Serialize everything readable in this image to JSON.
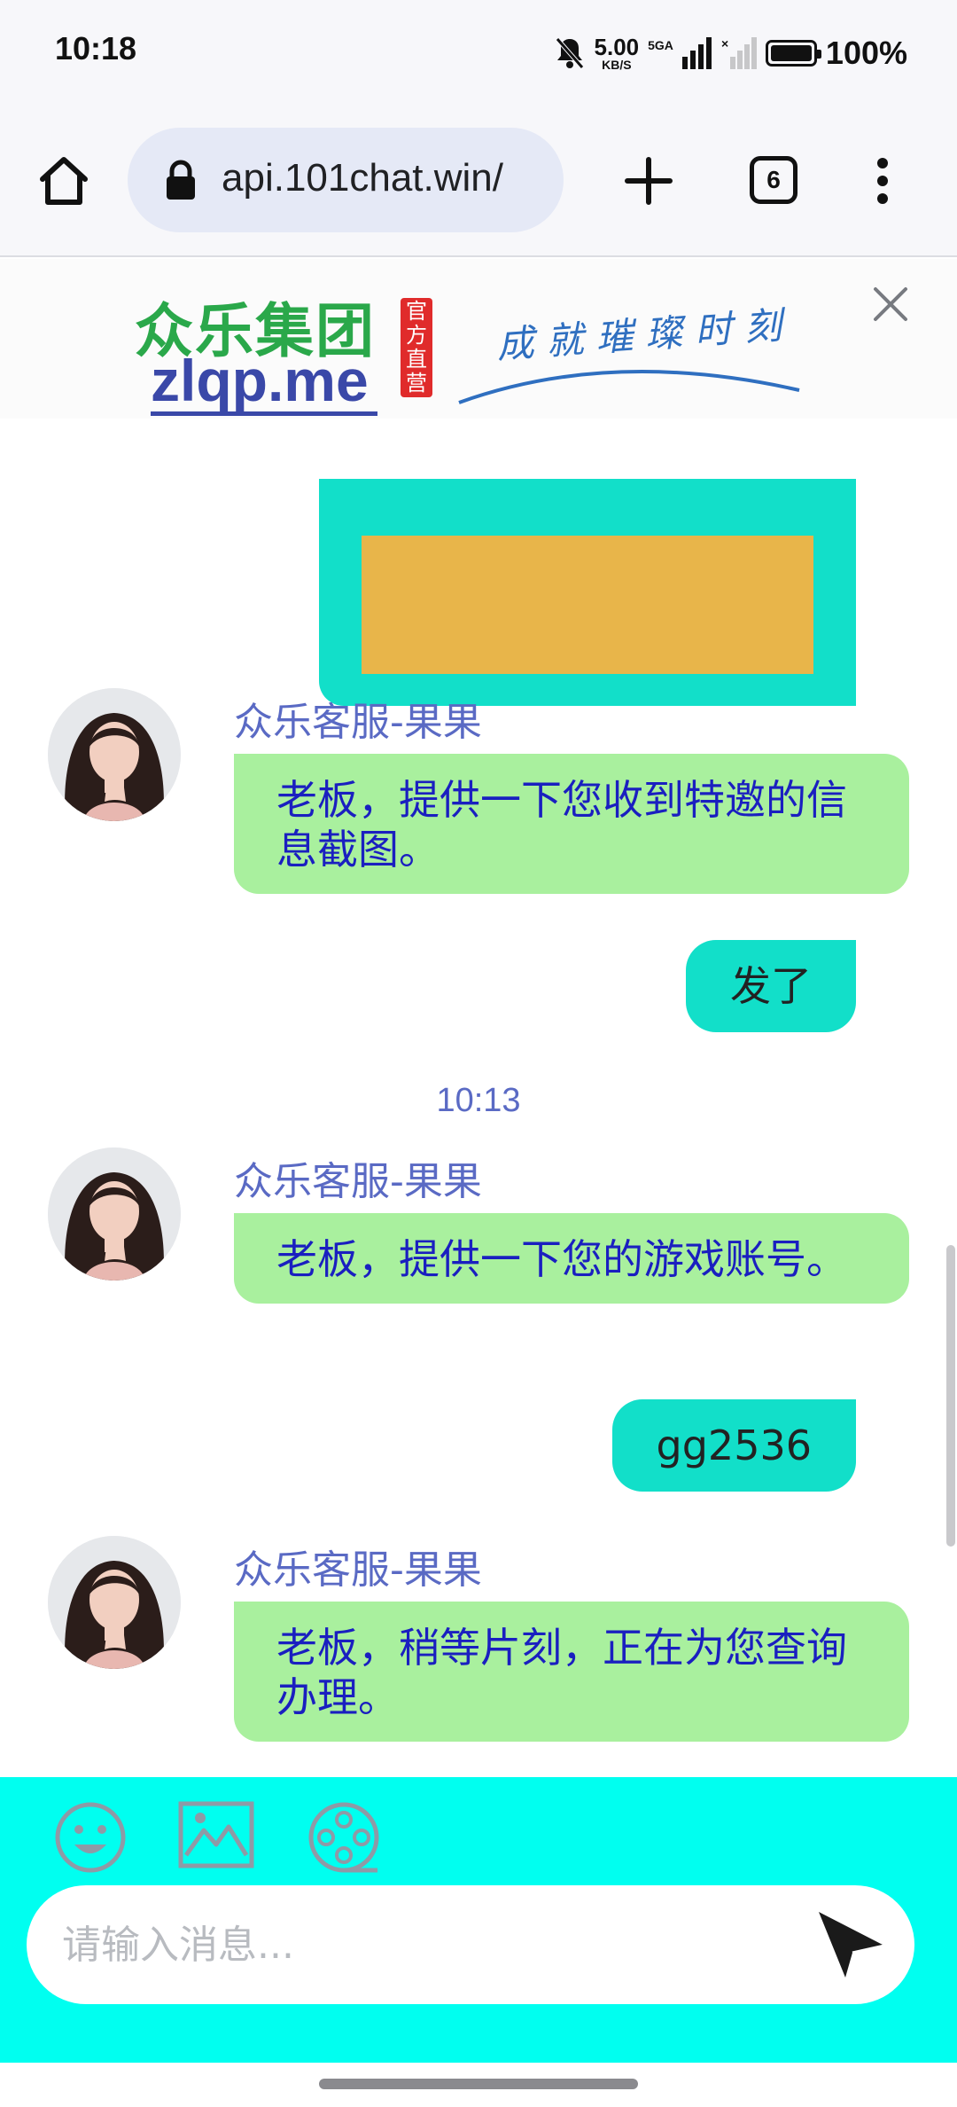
{
  "status_bar": {
    "time": "10:18",
    "net_speed": "5.00",
    "net_speed_unit": "KB/S",
    "signal_label": "5GA",
    "battery": "100%",
    "icons": [
      "mute-bell-icon",
      "signal-icon",
      "no-signal-icon",
      "battery-icon"
    ]
  },
  "browser": {
    "url": "api.101chat.win/",
    "tab_count": "6",
    "icons": [
      "home-icon",
      "lock-icon",
      "plus-icon",
      "more-vert-icon"
    ]
  },
  "ad": {
    "brand": "众乐集团",
    "domain": "zlqp.me",
    "seal": "官方直营",
    "slogan": "成就璀璨时刻"
  },
  "chat": {
    "messages": [
      {
        "type": "out-image",
        "sender": "",
        "text": "",
        "color": "#e8b54a"
      },
      {
        "type": "in",
        "sender": "众乐客服-果果",
        "text": "老板，提供一下您收到特邀的信息截图。"
      },
      {
        "type": "out",
        "sender": "",
        "text": "发了"
      },
      {
        "type": "time",
        "text": "10:13"
      },
      {
        "type": "in",
        "sender": "众乐客服-果果",
        "text": "老板，提供一下您的游戏账号。"
      },
      {
        "type": "out",
        "sender": "",
        "text": "gg2536"
      },
      {
        "type": "in",
        "sender": "众乐客服-果果",
        "text": "老板，稍等片刻，正在为您查询办理。"
      }
    ]
  },
  "input": {
    "placeholder": "请输入消息...",
    "tools": [
      "emoji-icon",
      "image-icon",
      "video-icon"
    ],
    "send_icon": "send-icon"
  },
  "colors": {
    "incoming_bubble": "#a9f09e",
    "outgoing_bubble": "#12dfc9",
    "input_area": "#00fff0",
    "sender_name": "#5a6ac4"
  }
}
